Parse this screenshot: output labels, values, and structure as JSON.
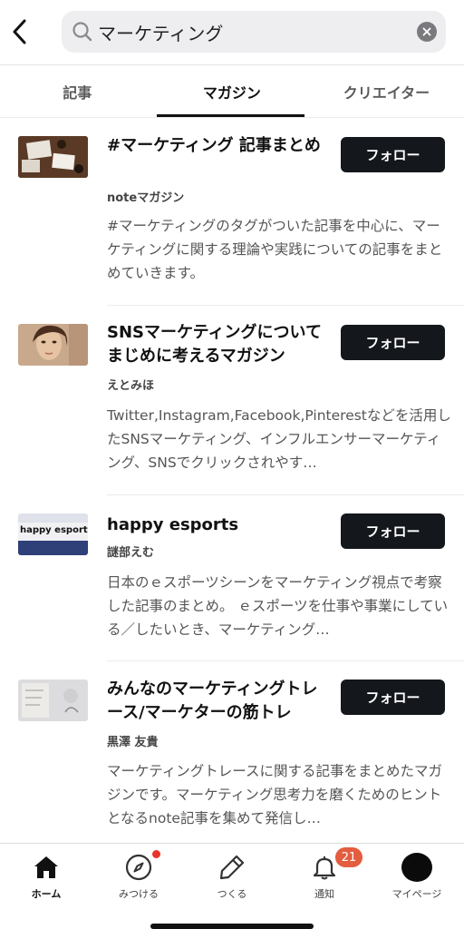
{
  "search": {
    "query": "マーケティング"
  },
  "tabs": [
    {
      "label": "記事",
      "active": false
    },
    {
      "label": "マガジン",
      "active": true
    },
    {
      "label": "クリエイター",
      "active": false
    }
  ],
  "magazines": [
    {
      "title": "#マーケティング 記事まとめ",
      "author": "noteマガジン",
      "description": "#マーケティングのタグがついた記事を中心に、マーケティングに関する理論や実践についての記事をまとめていきます。",
      "follow_label": "フォロー",
      "thumb_icon": "desk-photo-thumbnail"
    },
    {
      "title": "SNSマーケティングについてまじめに考えるマガジン",
      "author": "えとみほ",
      "description": "Twitter,Instagram,Facebook,Pinterestなどを活用したSNSマーケティング、インフルエンサーマーケティング、SNSでクリックされやす…",
      "follow_label": "フォロー",
      "thumb_icon": "portrait-photo-thumbnail"
    },
    {
      "title": "happy esports",
      "author": "謎部えむ",
      "description": "日本のｅスポーツシーンをマーケティング視点で考察した記事のまとめ。 ｅスポーツを仕事や事業にしている／したいとき、マーケティング…",
      "follow_label": "フォロー",
      "thumb_icon": "happy-esports-thumbnail",
      "thumb_text": "happy esports"
    },
    {
      "title": "みんなのマーケティングトレース/マーケターの筋トレ",
      "author": "黒澤 友貴",
      "description": "マーケティングトレースに関する記事をまとめたマガジンです。マーケティング思考力を磨くためのヒントとなるnote記事を集めて発信し…",
      "follow_label": "フォロー",
      "thumb_icon": "whiteboard-photo-thumbnail"
    }
  ],
  "bottom_nav": [
    {
      "label": "ホーム",
      "icon": "home-icon",
      "active": true
    },
    {
      "label": "みつける",
      "icon": "compass-icon",
      "active": false
    },
    {
      "label": "つくる",
      "icon": "pencil-icon",
      "active": false
    },
    {
      "label": "通知",
      "icon": "bell-icon",
      "active": false,
      "badge": "21"
    },
    {
      "label": "マイページ",
      "icon": "avatar",
      "active": false
    }
  ],
  "colors": {
    "follow_button": "#14171c",
    "badge": "#e35d3e",
    "notification_dot": "#e8322c",
    "search_bg": "#eeeef1"
  }
}
